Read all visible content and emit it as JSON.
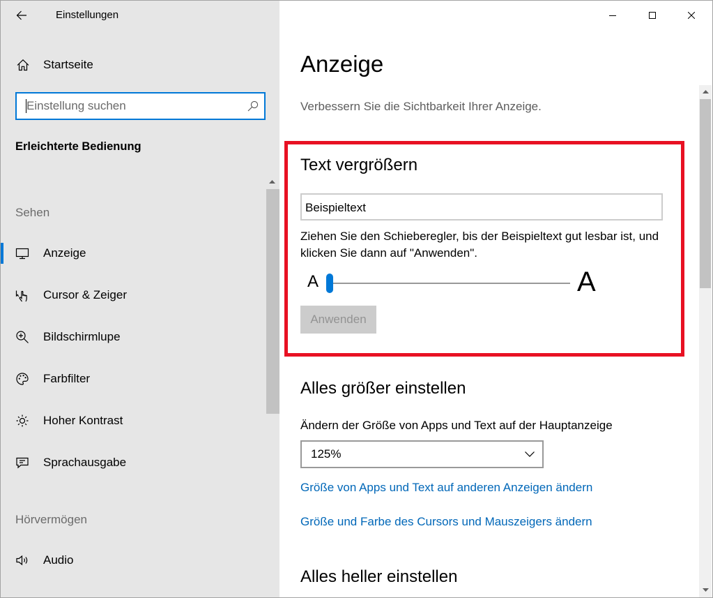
{
  "window": {
    "title": "Einstellungen",
    "controls": [
      "minimize-icon",
      "maximize-icon",
      "close-icon"
    ]
  },
  "colors": {
    "accent": "#0078d7",
    "highlight_border": "#e81123",
    "link": "#0067b8",
    "sidebar_background": "#e6e6e6"
  },
  "sidebar": {
    "back_icon": "back-arrow-icon",
    "home": {
      "label": "Startseite",
      "icon": "home-icon"
    },
    "search": {
      "placeholder": "Einstellung suchen",
      "icon": "search-icon"
    },
    "category_title": "Erleichterte Bedienung",
    "sections": [
      {
        "header": "Sehen",
        "items": [
          {
            "label": "Anzeige",
            "icon": "monitor-icon",
            "selected": true
          },
          {
            "label": "Cursor & Zeiger",
            "icon": "hand-pointer-icon"
          },
          {
            "label": "Bildschirmlupe",
            "icon": "magnifier-plus-icon"
          },
          {
            "label": "Farbfilter",
            "icon": "palette-icon"
          },
          {
            "label": "Hoher Kontrast",
            "icon": "brightness-icon"
          },
          {
            "label": "Sprachausgabe",
            "icon": "narrator-icon"
          }
        ]
      },
      {
        "header": "Hörvermögen",
        "items": [
          {
            "label": "Audio",
            "icon": "speaker-icon"
          }
        ]
      }
    ]
  },
  "main": {
    "title": "Anzeige",
    "subtitle": "Verbessern Sie die Sichtbarkeit Ihrer Anzeige.",
    "text_size": {
      "heading": "Text vergrößern",
      "sample_text": "Beispieltext",
      "description": "Ziehen Sie den Schieberegler, bis der Beispieltext gut lesbar ist, und klicken Sie dann auf \"Anwenden\".",
      "slider_min_label": "A",
      "slider_max_label": "A",
      "slider_position": 0,
      "apply_label": "Anwenden",
      "apply_enabled": false
    },
    "bigger": {
      "heading": "Alles größer einstellen",
      "scale_label": "Ändern der Größe von Apps und Text auf der Hauptanzeige",
      "scale_value": "125%",
      "links": [
        "Größe von Apps und Text auf anderen Anzeigen ändern",
        "Größe und Farbe des Cursors und Mauszeigers ändern"
      ]
    },
    "brighter": {
      "heading": "Alles heller einstellen"
    }
  }
}
